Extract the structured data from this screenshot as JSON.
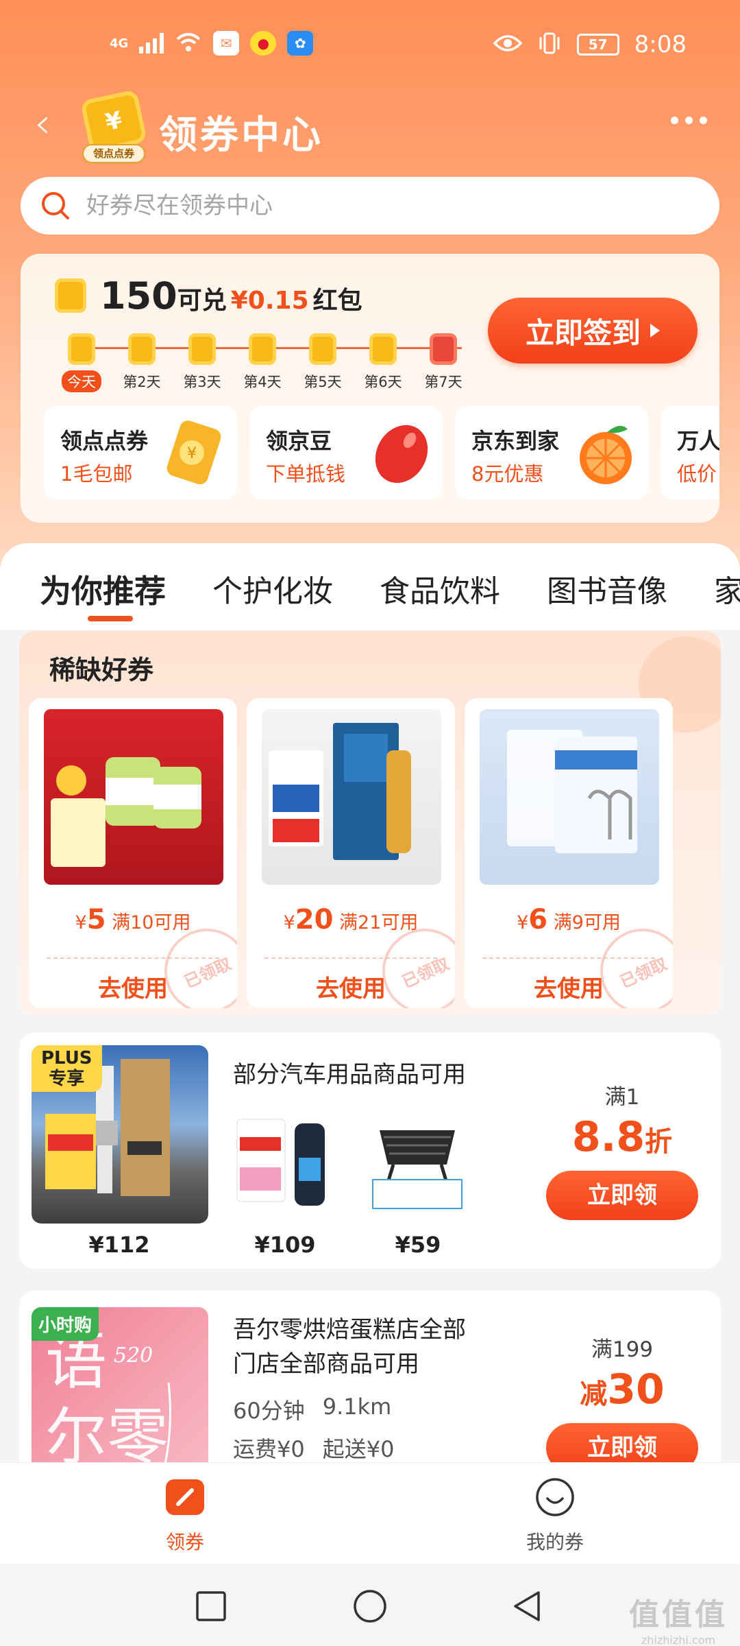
{
  "status_bar": {
    "network": "4G",
    "battery": "57",
    "time": "8:08"
  },
  "header": {
    "back_icon": "chevron-left-icon",
    "logo_tag": "领点点券",
    "title": "领券中心",
    "more_icon": "more-dots-icon"
  },
  "search": {
    "placeholder": "好券尽在领券中心"
  },
  "signin": {
    "points": "150",
    "redeem_text": "可兑",
    "amount": "¥0.15",
    "reward": "红包",
    "button": "立即签到",
    "days": [
      "今天",
      "第2天",
      "第3天",
      "第4天",
      "第5天",
      "第6天",
      "第7天"
    ]
  },
  "mini_cards": [
    {
      "title": "领点点券",
      "sub": "1毛包邮"
    },
    {
      "title": "领京豆",
      "sub": "下单抵钱"
    },
    {
      "title": "京东到家",
      "sub": "8元优惠"
    },
    {
      "title": "万人",
      "sub": "低价"
    }
  ],
  "tabs": [
    "为你推荐",
    "个护化妆",
    "食品饮料",
    "图书音像",
    "家"
  ],
  "scarce": {
    "title": "稀缺好券",
    "coupons": [
      {
        "amount": "5",
        "cond": "满10可用",
        "action": "去使用",
        "stamp": "已领取"
      },
      {
        "amount": "20",
        "cond": "满21可用",
        "action": "去使用",
        "stamp": "已领取"
      },
      {
        "amount": "6",
        "cond": "满9可用",
        "action": "去使用",
        "stamp": "已领取"
      }
    ]
  },
  "car_card": {
    "badge_line1": "PLUS",
    "badge_line2": "专享",
    "title": "部分汽车用品商品可用",
    "prices": [
      "¥112",
      "¥109",
      "¥59"
    ],
    "cond": "满1",
    "discount": "8.8",
    "discount_unit": "折",
    "button": "立即领"
  },
  "bakery_card": {
    "badge": "小时购",
    "title_line1": "吾尔零烘焙蛋糕店全部",
    "title_line2": "门店全部商品可用",
    "time": "60分钟",
    "distance": "9.1km",
    "shipping": "运费¥0",
    "min_order": "起送¥0",
    "cond": "满199",
    "discount_prefix": "减",
    "discount": "30",
    "button": "立即领",
    "logo_text": "语 520 尔零"
  },
  "bottom_nav": [
    {
      "label": "领券",
      "icon": "coupon-icon",
      "active": true
    },
    {
      "label": "我的券",
      "icon": "smile-icon",
      "active": false
    }
  ],
  "watermark": {
    "line1": "值值值",
    "line2": "zhizhizhi.com"
  },
  "colors": {
    "accent": "#f2501a",
    "header_bg": "#ff8f57",
    "gold": "#f7b918"
  }
}
